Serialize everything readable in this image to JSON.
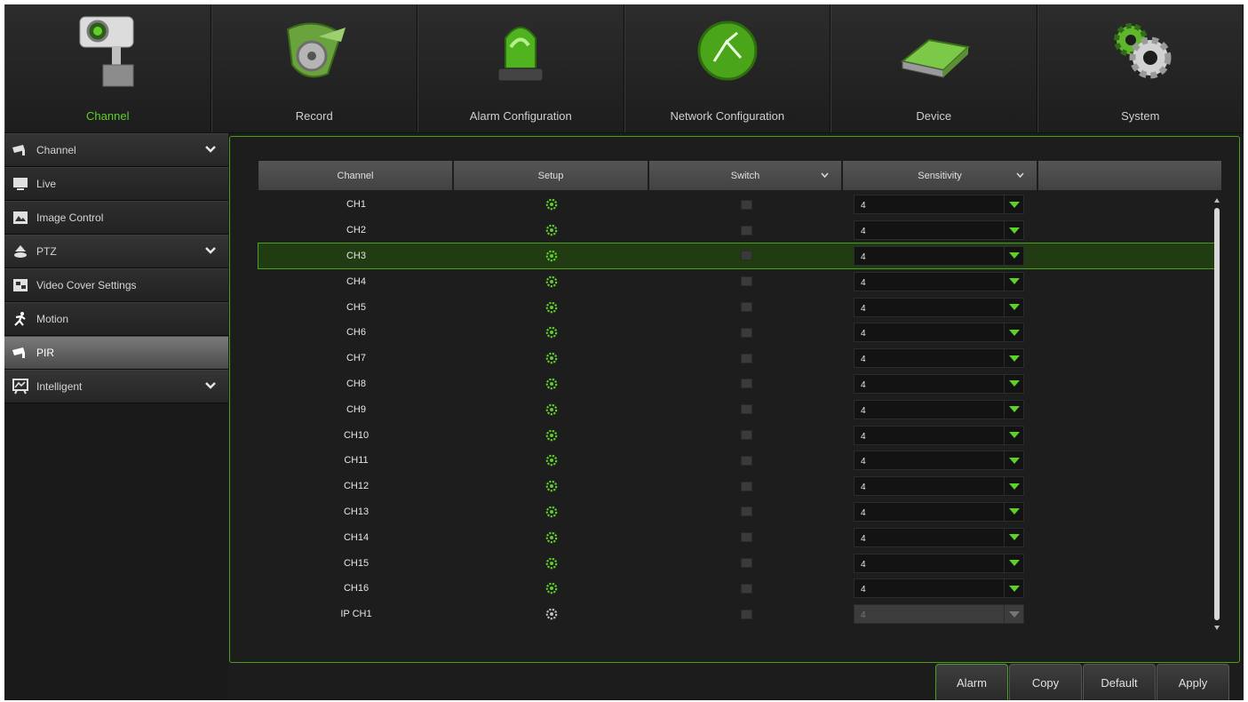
{
  "nav": {
    "tabs": [
      {
        "label": "Channel",
        "active": true
      },
      {
        "label": "Record"
      },
      {
        "label": "Alarm Configuration"
      },
      {
        "label": "Network Configuration"
      },
      {
        "label": "Device"
      },
      {
        "label": "System"
      }
    ]
  },
  "sidebar": {
    "items": [
      {
        "label": "Channel",
        "expandable": true
      },
      {
        "label": "Live"
      },
      {
        "label": "Image Control"
      },
      {
        "label": "PTZ",
        "expandable": true
      },
      {
        "label": "Video Cover Settings"
      },
      {
        "label": "Motion"
      },
      {
        "label": "PIR",
        "selected": true
      },
      {
        "label": "Intelligent",
        "expandable": true
      }
    ]
  },
  "table": {
    "headers": {
      "channel": "Channel",
      "setup": "Setup",
      "switch": "Switch",
      "sensitivity": "Sensitivity"
    },
    "rows": [
      {
        "channel": "CH1",
        "sensitivity": "4"
      },
      {
        "channel": "CH2",
        "sensitivity": "4"
      },
      {
        "channel": "CH3",
        "sensitivity": "4",
        "selected": true
      },
      {
        "channel": "CH4",
        "sensitivity": "4"
      },
      {
        "channel": "CH5",
        "sensitivity": "4"
      },
      {
        "channel": "CH6",
        "sensitivity": "4"
      },
      {
        "channel": "CH7",
        "sensitivity": "4"
      },
      {
        "channel": "CH8",
        "sensitivity": "4"
      },
      {
        "channel": "CH9",
        "sensitivity": "4"
      },
      {
        "channel": "CH10",
        "sensitivity": "4"
      },
      {
        "channel": "CH11",
        "sensitivity": "4"
      },
      {
        "channel": "CH12",
        "sensitivity": "4"
      },
      {
        "channel": "CH13",
        "sensitivity": "4"
      },
      {
        "channel": "CH14",
        "sensitivity": "4"
      },
      {
        "channel": "CH15",
        "sensitivity": "4"
      },
      {
        "channel": "CH16",
        "sensitivity": "4"
      },
      {
        "channel": "IP CH1",
        "sensitivity": "4",
        "disabled": true
      }
    ]
  },
  "buttons": {
    "alarm": "Alarm",
    "copy": "Copy",
    "default": "Default",
    "apply": "Apply"
  },
  "colors": {
    "accent": "#5fcf2a",
    "border": "#49a01c"
  }
}
